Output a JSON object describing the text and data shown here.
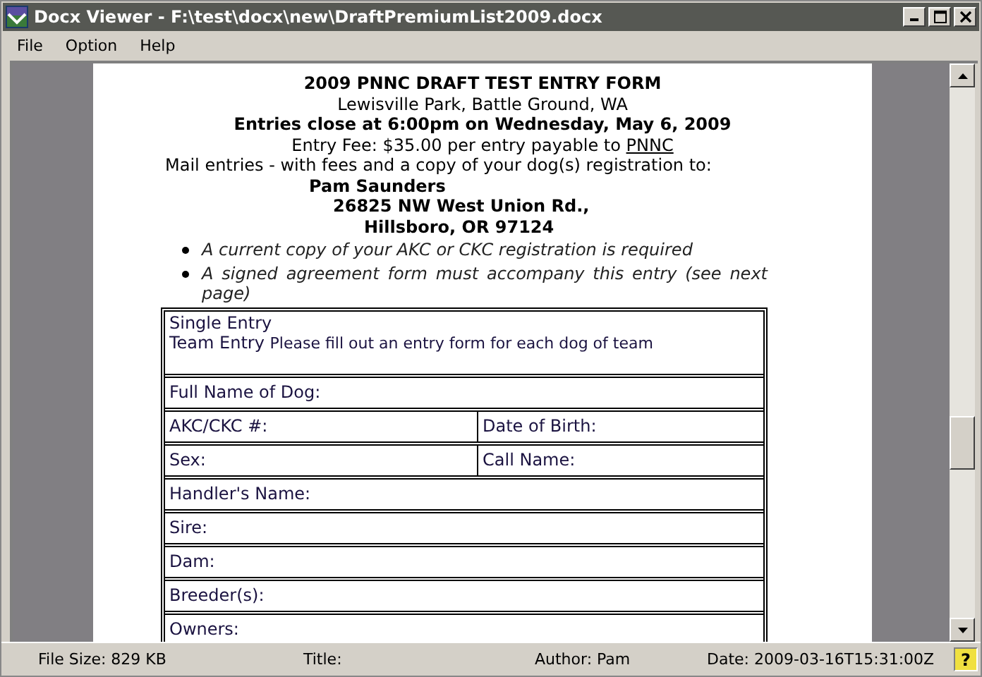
{
  "window": {
    "title": "Docx Viewer - F:\\test\\docx\\new\\DraftPremiumList2009.docx"
  },
  "menu": [
    "File",
    "Option",
    "Help"
  ],
  "document": {
    "heading": [
      {
        "kind": "bold",
        "text": "2009 PNNC DRAFT TEST ENTRY FORM"
      },
      {
        "kind": "normal",
        "text": "Lewisville Park, Battle Ground, WA"
      },
      {
        "kind": "bold",
        "text": "Entries close at 6:00pm on Wednesday, May 6, 2009"
      }
    ],
    "fee": {
      "text": "Entry Fee: $35.00 per entry payable to",
      "link": "PNNC"
    },
    "mail": "Mail entries - with fees and a copy of your dog(s) registration to:",
    "address": [
      "Pam Saunders",
      "26825 NW West Union Rd.,",
      "Hillsboro, OR 97124"
    ],
    "bullets": [
      "A current copy of your AKC or CKC registration is required",
      "A signed agreement form must accompany this entry (see next page)"
    ],
    "entry_types": {
      "single": "Single Entry",
      "team": "Team Entry",
      "team_note": "Please fill out an entry form for each dog of team"
    },
    "form_rows": [
      {
        "kind": "full",
        "cells": [
          "Full Name of Dog:"
        ]
      },
      {
        "kind": "split",
        "cells": [
          "AKC/CKC #:",
          "Date of Birth:"
        ]
      },
      {
        "kind": "split",
        "cells": [
          "Sex:",
          "Call Name:"
        ]
      },
      {
        "kind": "full",
        "cells": [
          "Handler's Name:"
        ]
      },
      {
        "kind": "full",
        "cells": [
          "Sire:"
        ]
      },
      {
        "kind": "full",
        "cells": [
          "Dam:"
        ]
      },
      {
        "kind": "full",
        "cells": [
          "Breeder(s):"
        ]
      },
      {
        "kind": "full",
        "cells": [
          "Owners:"
        ]
      }
    ]
  },
  "status_bar": {
    "file_size": "File Size: 829 KB",
    "title": "Title:",
    "author": "Author: Pam",
    "date": "Date: 2009-03-16T15:31:00Z",
    "help": "?"
  }
}
